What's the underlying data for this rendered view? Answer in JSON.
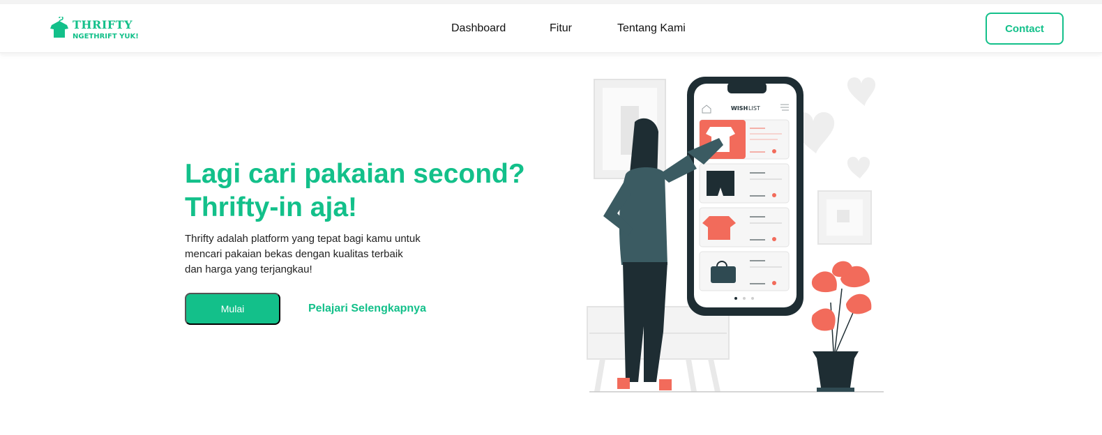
{
  "brand": {
    "name": "THRIFTY",
    "tagline": "NGETHRIFT YUK!",
    "color": "#13c08a"
  },
  "nav": {
    "items": [
      "Dashboard",
      "Fitur",
      "Tentang Kami"
    ],
    "contact_label": "Contact"
  },
  "hero": {
    "title_line1": "Lagi cari pakaian second?",
    "title_line2": "Thrifty-in aja!",
    "description": "Thrifty adalah platform yang tepat bagi kamu untuk mencari pakaian bekas dengan kualitas terbaik dan harga yang terjangkau!",
    "primary_button": "Mulai",
    "secondary_link": "Pelajari Selengkapnya"
  },
  "illustration": {
    "screen_title_bold": "WISH",
    "screen_title_light": "LIST",
    "accent_color": "#f26b5b",
    "dark_color": "#1e2d33"
  }
}
